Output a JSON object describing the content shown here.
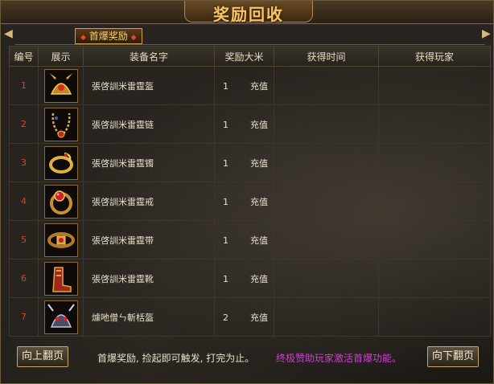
{
  "window": {
    "title": "奖励回收"
  },
  "tab": {
    "label": "首爆奖励"
  },
  "columns": [
    "编号",
    "展示",
    "装备名字",
    "奖励大米",
    "获得时间",
    "获得玩家"
  ],
  "rows": [
    {
      "num": "1",
      "icon": "dragon-helmet-icon",
      "name": "張啓訓⽶雷霆盔",
      "amount": "1",
      "type": "充值",
      "time": "",
      "player": ""
    },
    {
      "num": "2",
      "icon": "dragon-necklace-icon",
      "name": "張啓訓⽶雷霆链",
      "amount": "1",
      "type": "充值",
      "time": "",
      "player": ""
    },
    {
      "num": "3",
      "icon": "dragon-bracelet-icon",
      "name": "張啓訓⽶雷霆镯",
      "amount": "1",
      "type": "充值",
      "time": "",
      "player": ""
    },
    {
      "num": "4",
      "icon": "ruby-ring-icon",
      "name": "張啓訓⽶雷霆戒",
      "amount": "1",
      "type": "充值",
      "time": "",
      "player": ""
    },
    {
      "num": "5",
      "icon": "ruby-belt-icon",
      "name": "張啓訓⽶雷霆带",
      "amount": "1",
      "type": "充值",
      "time": "",
      "player": ""
    },
    {
      "num": "6",
      "icon": "dragon-boots-icon",
      "name": "張啓訓⽶雷霆靴",
      "amount": "1",
      "type": "充值",
      "time": "",
      "player": ""
    },
    {
      "num": "7",
      "icon": "demon-helmet-icon",
      "name": "㷾吔僧ㄣ斬栝盔",
      "amount": "2",
      "type": "充值",
      "time": "",
      "player": ""
    }
  ],
  "footer": {
    "prev_label": "向上翻页",
    "next_label": "向下翻页",
    "note_left": "首爆奖励, 捡起即可触发, 打完为止。",
    "note_right": "终极赞助玩家激活首爆功能。"
  },
  "colors": {
    "accent_gold": "#f3c66a",
    "row_number": "#d24a2a",
    "note_right": "#d040d0"
  }
}
